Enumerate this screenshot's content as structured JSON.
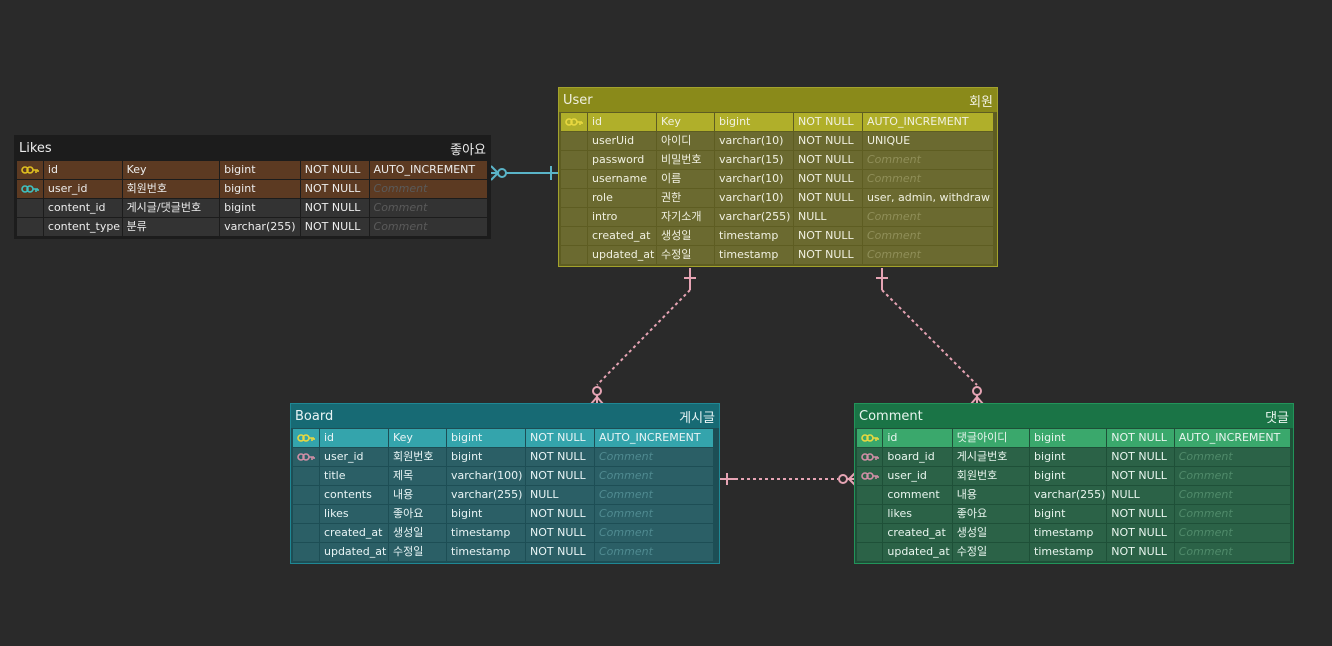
{
  "tables": {
    "likes": {
      "name": "Likes",
      "label": "좋아요",
      "rows": [
        {
          "key": "pk",
          "cols": [
            "id",
            "Key",
            "bigint",
            "NOT NULL",
            "AUTO_INCREMENT"
          ]
        },
        {
          "key": "fk",
          "cols": [
            "user_id",
            "회원번호",
            "bigint",
            "NOT NULL",
            "Comment"
          ]
        },
        {
          "key": "",
          "cols": [
            "content_id",
            "게시글/댓글번호",
            "bigint",
            "NOT NULL",
            "Comment"
          ]
        },
        {
          "key": "",
          "cols": [
            "content_type",
            "분류",
            "varchar(255)",
            "NOT NULL",
            "Comment"
          ]
        }
      ]
    },
    "user": {
      "name": "User",
      "label": "회원",
      "rows": [
        {
          "key": "pk",
          "cols": [
            "id",
            "Key",
            "bigint",
            "NOT NULL",
            "AUTO_INCREMENT"
          ]
        },
        {
          "key": "",
          "cols": [
            "userUid",
            "아이디",
            "varchar(10)",
            "NOT NULL",
            "UNIQUE"
          ]
        },
        {
          "key": "",
          "cols": [
            "password",
            "비밀번호",
            "varchar(15)",
            "NOT NULL",
            "Comment"
          ]
        },
        {
          "key": "",
          "cols": [
            "username",
            "이름",
            "varchar(10)",
            "NOT NULL",
            "Comment"
          ]
        },
        {
          "key": "",
          "cols": [
            "role",
            "권한",
            "varchar(10)",
            "NOT NULL",
            "user, admin, withdraw"
          ]
        },
        {
          "key": "",
          "cols": [
            "intro",
            "자기소개",
            "varchar(255)",
            "NULL",
            "Comment"
          ]
        },
        {
          "key": "",
          "cols": [
            "created_at",
            "생성일",
            "timestamp",
            "NOT NULL",
            "Comment"
          ]
        },
        {
          "key": "",
          "cols": [
            "updated_at",
            "수정일",
            "timestamp",
            "NOT NULL",
            "Comment"
          ]
        }
      ]
    },
    "board": {
      "name": "Board",
      "label": "게시글",
      "rows": [
        {
          "key": "pk",
          "cols": [
            "id",
            "Key",
            "bigint",
            "NOT NULL",
            "AUTO_INCREMENT"
          ]
        },
        {
          "key": "fk",
          "cols": [
            "user_id",
            "회원번호",
            "bigint",
            "NOT NULL",
            "Comment"
          ]
        },
        {
          "key": "",
          "cols": [
            "title",
            "제목",
            "varchar(100)",
            "NOT NULL",
            "Comment"
          ]
        },
        {
          "key": "",
          "cols": [
            "contents",
            "내용",
            "varchar(255)",
            "NULL",
            "Comment"
          ]
        },
        {
          "key": "",
          "cols": [
            "likes",
            "좋아요",
            "bigint",
            "NOT NULL",
            "Comment"
          ]
        },
        {
          "key": "",
          "cols": [
            "created_at",
            "생성일",
            "timestamp",
            "NOT NULL",
            "Comment"
          ]
        },
        {
          "key": "",
          "cols": [
            "updated_at",
            "수정일",
            "timestamp",
            "NOT NULL",
            "Comment"
          ]
        }
      ]
    },
    "comment": {
      "name": "Comment",
      "label": "댓글",
      "rows": [
        {
          "key": "pk",
          "cols": [
            "id",
            "댓글아이디",
            "bigint",
            "NOT NULL",
            "AUTO_INCREMENT"
          ]
        },
        {
          "key": "fk",
          "cols": [
            "board_id",
            "게시글번호",
            "bigint",
            "NOT NULL",
            "Comment"
          ]
        },
        {
          "key": "fk",
          "cols": [
            "user_id",
            "회원번호",
            "bigint",
            "NOT NULL",
            "Comment"
          ]
        },
        {
          "key": "",
          "cols": [
            "comment",
            "내용",
            "varchar(255)",
            "NULL",
            "Comment"
          ]
        },
        {
          "key": "",
          "cols": [
            "likes",
            "좋아요",
            "bigint",
            "NOT NULL",
            "Comment"
          ]
        },
        {
          "key": "",
          "cols": [
            "created_at",
            "생성일",
            "timestamp",
            "NOT NULL",
            "Comment"
          ]
        },
        {
          "key": "",
          "cols": [
            "updated_at",
            "수정일",
            "timestamp",
            "NOT NULL",
            "Comment"
          ]
        }
      ]
    }
  },
  "colors": {
    "background": "#2a2a2a",
    "likes": {
      "head": "#1c1c1c",
      "body": "#1c1c1c",
      "border": "#1c1c1c",
      "pk": "#5c3a22",
      "fk": "#5c3a22",
      "cell": "#333333",
      "text": "#ececec",
      "comment": "#5a5a5a",
      "pkIcon": "#e0c020",
      "fkIcon": "#3fc0c0"
    },
    "user": {
      "head": "#8a8a1a",
      "body": "#5e5d22",
      "border": "#a3a22c",
      "pk": "#b0af2a",
      "fk": "#b0af2a",
      "cell": "#6b6a30",
      "text": "#f0f0e0",
      "comment": "#8f8e58",
      "pkIcon": "#e8d840",
      "fkIcon": "#e8d840"
    },
    "board": {
      "head": "#176a74",
      "body": "#1d4e55",
      "border": "#1f8794",
      "pk": "#34a4ac",
      "fk": "#2b5f66",
      "cell": "#2b5f66",
      "text": "#e8f4f5",
      "comment": "#4f8a90",
      "pkIcon": "#e8d840",
      "fkIcon": "#d08fa6"
    },
    "comment": {
      "head": "#1a7446",
      "body": "#1e5038",
      "border": "#22945a",
      "pk": "#3aa86c",
      "fk": "#2b6247",
      "cell": "#2b6247",
      "text": "#e8f5ee",
      "comment": "#4f8a6a",
      "pkIcon": "#e8d840",
      "fkIcon": "#d08fa6"
    },
    "line_user_likes": "#5ab4c8",
    "line_pink": "#e6a4b4"
  }
}
